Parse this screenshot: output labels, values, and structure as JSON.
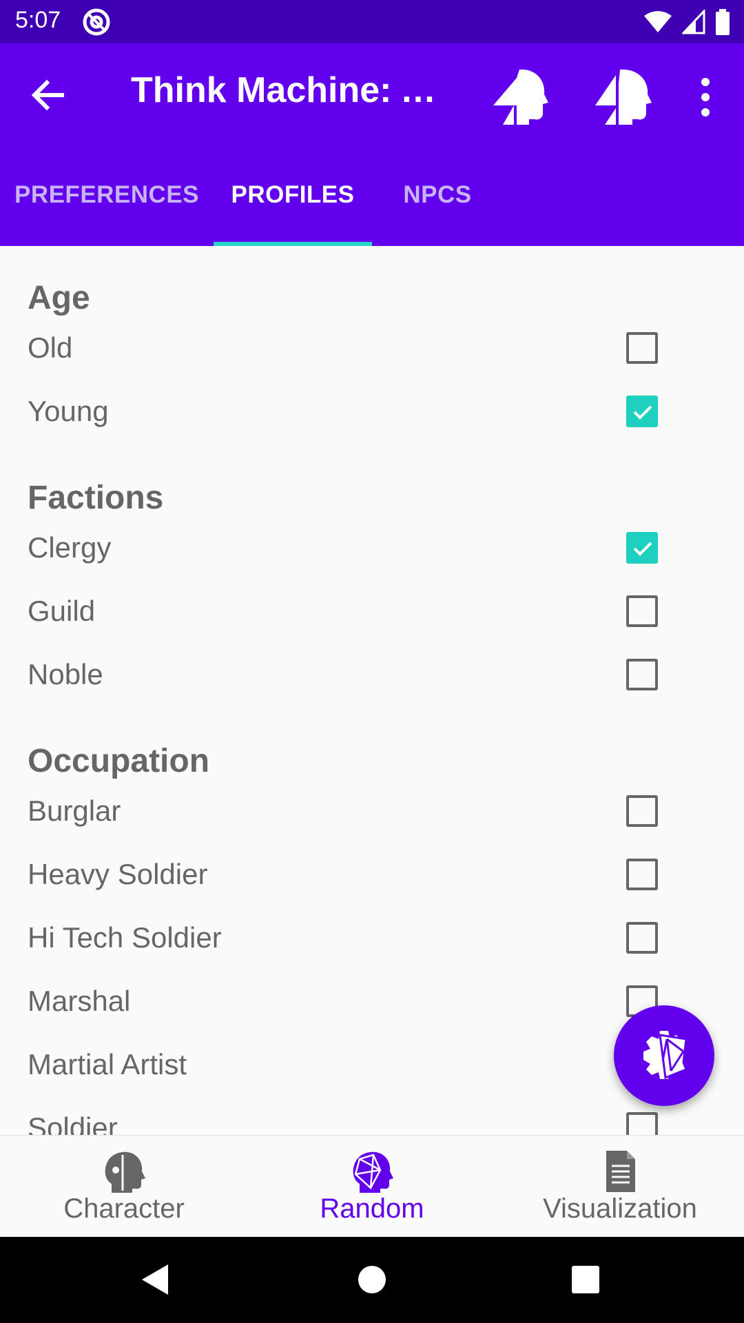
{
  "status_bar": {
    "time": "5:07"
  },
  "app_bar": {
    "title": "Think Machine: A..."
  },
  "tabs": [
    {
      "label": "PREFERENCES",
      "active": false
    },
    {
      "label": "PROFILES",
      "active": true
    },
    {
      "label": "NPCS",
      "active": false
    }
  ],
  "sections": [
    {
      "title": "Age",
      "items": [
        {
          "label": "Old",
          "checked": false
        },
        {
          "label": "Young",
          "checked": true
        }
      ]
    },
    {
      "title": "Factions",
      "items": [
        {
          "label": "Clergy",
          "checked": true
        },
        {
          "label": "Guild",
          "checked": false
        },
        {
          "label": "Noble",
          "checked": false
        }
      ]
    },
    {
      "title": "Occupation",
      "items": [
        {
          "label": "Burglar",
          "checked": false
        },
        {
          "label": "Heavy Soldier",
          "checked": false
        },
        {
          "label": "Hi Tech Soldier",
          "checked": false
        },
        {
          "label": "Marshal",
          "checked": false
        },
        {
          "label": "Martial Artist",
          "checked": false
        },
        {
          "label": "Soldier",
          "checked": false
        }
      ]
    }
  ],
  "bottom_nav": [
    {
      "label": "Character",
      "icon": "head-gear-icon",
      "active": false
    },
    {
      "label": "Random",
      "icon": "head-polygon-icon",
      "active": true
    },
    {
      "label": "Visualization",
      "icon": "document-icon",
      "active": false
    }
  ],
  "colors": {
    "primary": "#6200ee",
    "status_bar": "#3f00b3",
    "accent": "#1fcfc0",
    "text": "#666666"
  }
}
